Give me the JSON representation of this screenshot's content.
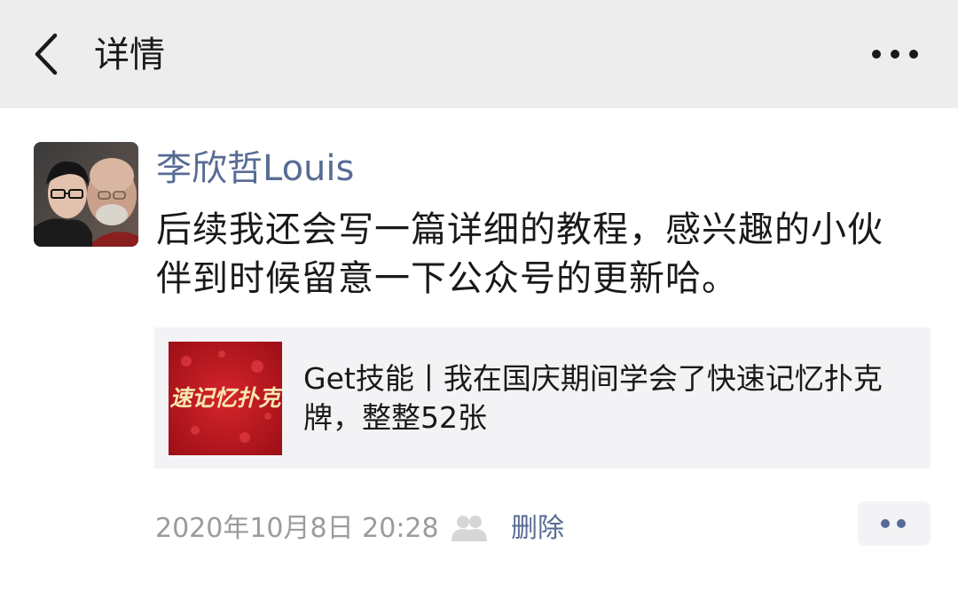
{
  "header": {
    "title": "详情",
    "back_icon": "chevron-left-icon",
    "more_icon": "more-dots-icon"
  },
  "post": {
    "author": "李欣哲Louis",
    "text": "后续我还会写一篇详细的教程，感兴趣的小伙伴到时候留意一下公众号的更新哈。",
    "link": {
      "title": "Get技能丨我在国庆期间学会了快速记忆扑克牌，整整52张",
      "thumbnail_text": "速记忆扑克"
    },
    "timestamp": "2020年10月8日 20:28",
    "visibility_icon": "friends-icon",
    "delete_label": "删除",
    "action_icon": "comment-like-menu-icon"
  },
  "colors": {
    "header_bg": "#ededed",
    "link_blue": "#576b95",
    "text_primary": "#191919",
    "text_secondary": "#9b9b9b",
    "card_bg": "#f3f3f5",
    "thumb_red": "#b5121b"
  }
}
